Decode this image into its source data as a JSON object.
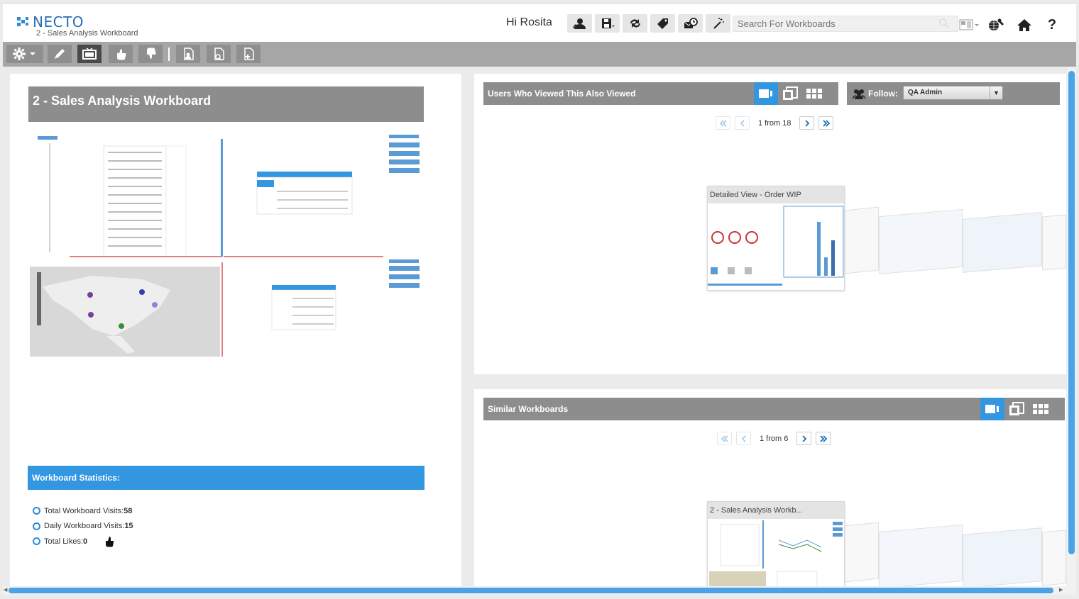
{
  "app": {
    "logo_text": "NECTO",
    "workboard_name": "2 - Sales Analysis Workboard",
    "greeting": "Hi Rosita"
  },
  "search": {
    "placeholder": "Search For Workboards"
  },
  "header_icons": [
    "users-icon",
    "save-icon",
    "share-icon",
    "tag-icon",
    "schedule-mail-icon",
    "magic-wand-icon"
  ],
  "header_right_icons": [
    "layout-select-icon",
    "globe-settings-icon",
    "home-icon",
    "help-icon"
  ],
  "help_label": "?",
  "toolbar": {
    "buttons": [
      "settings-icon",
      "edit-icon",
      "presentation-icon",
      "like-icon",
      "dislike-icon",
      "new-page-icon",
      "preview-page-icon",
      "add-page-icon"
    ],
    "active": "presentation-icon"
  },
  "workboard": {
    "title": "2 - Sales Analysis Workboard",
    "statistics_title": "Workboard Statistics:",
    "stats": [
      {
        "label": "Total Workboard Visits:",
        "value": "58"
      },
      {
        "label": "Daily Workboard Visits:",
        "value": "15"
      },
      {
        "label": "Total Likes:",
        "value": "0"
      }
    ]
  },
  "also_viewed": {
    "title": "Users Who Viewed This Also Viewed",
    "follow_label": "Follow:",
    "follow_value": "QA Admin",
    "pager": {
      "current": "1",
      "total": "18",
      "text": "1 from 18"
    },
    "card_title": "Detailed View - Order WIP"
  },
  "similar": {
    "title": "Similar Workboards",
    "pager": {
      "current": "1",
      "total": "6",
      "text": "1 from 6"
    },
    "card_title": "2 - Sales Analysis Workb..."
  },
  "colors": {
    "accent": "#3396e0",
    "header_gray": "#8d8d8d",
    "toolbar_gray": "#a6a6a6",
    "active_button": "#4a4a4a"
  }
}
